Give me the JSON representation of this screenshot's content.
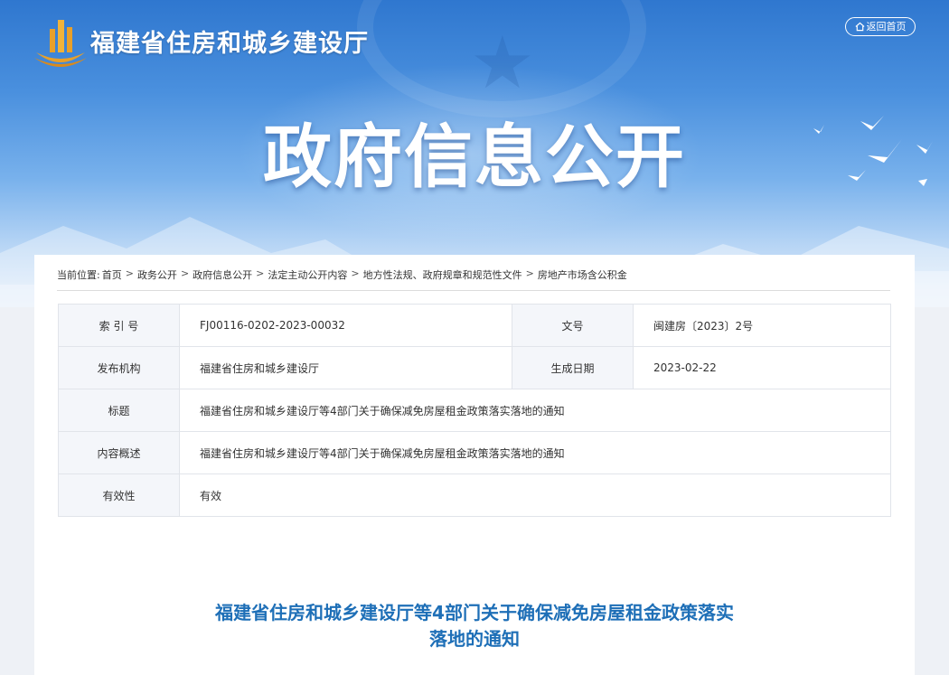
{
  "header": {
    "site_name": "福建省住房和城乡建设厅",
    "back_home": "返回首页",
    "hero_title": "政府信息公开"
  },
  "breadcrumb": {
    "label": "当前位置:",
    "items": [
      "首页",
      "政务公开",
      "政府信息公开",
      "法定主动公开内容",
      "地方性法规、政府规章和规范性文件",
      "房地产市场含公积金"
    ],
    "separator": ">"
  },
  "meta": {
    "index_label": "索 引 号",
    "index_value": "FJ00116-0202-2023-00032",
    "docno_label": "文号",
    "docno_value": "闽建房〔2023〕2号",
    "publisher_label": "发布机构",
    "publisher_value": "福建省住房和城乡建设厅",
    "date_label": "生成日期",
    "date_value": "2023-02-22",
    "title_label": "标题",
    "title_value": "福建省住房和城乡建设厅等4部门关于确保减免房屋租金政策落实落地的通知",
    "summary_label": "内容概述",
    "summary_value": "福建省住房和城乡建设厅等4部门关于确保减免房屋租金政策落实落地的通知",
    "validity_label": "有效性",
    "validity_value": "有效"
  },
  "document": {
    "title_line1": "福建省住房和城乡建设厅等4部门关于确保减免房屋租金政策落实",
    "title_line2": "落地的通知"
  },
  "icons": {
    "logo": "building-logo-icon",
    "home": "home-icon",
    "birds": "dove-icon"
  },
  "colors": {
    "banner_blue": "#3a83d6",
    "title_blue": "#1e6fb7",
    "logo_gold": "#e8a02a"
  }
}
